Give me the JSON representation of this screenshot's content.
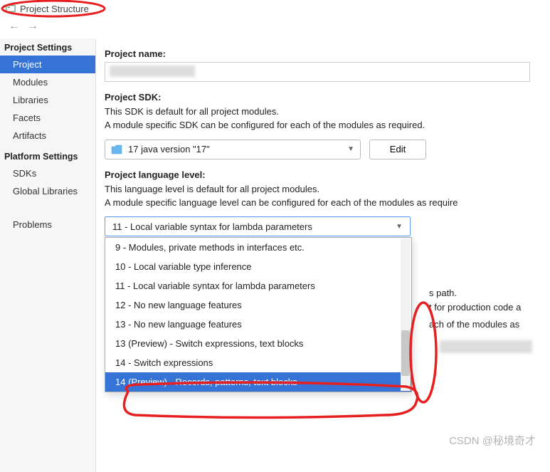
{
  "title": "Project Structure",
  "sidebar": {
    "heading1": "Project Settings",
    "items1": [
      "Project",
      "Modules",
      "Libraries",
      "Facets",
      "Artifacts"
    ],
    "heading2": "Platform Settings",
    "items2": [
      "SDKs",
      "Global Libraries"
    ],
    "problems": "Problems"
  },
  "content": {
    "projectName": {
      "label": "Project name:"
    },
    "sdk": {
      "label": "Project SDK:",
      "help1": "This SDK is default for all project modules.",
      "help2": "A module specific SDK can be configured for each of the modules as required.",
      "value": "17 java version \"17\"",
      "editLabel": "Edit"
    },
    "lang": {
      "label": "Project language level:",
      "help1": "This language level is default for all project modules.",
      "help2": "A module specific language level can be configured for each of the modules as require",
      "selected": "11 - Local variable syntax for lambda parameters",
      "options": [
        "9 - Modules, private methods in interfaces etc.",
        "10 - Local variable type inference",
        "11 - Local variable syntax for lambda parameters",
        "12 - No new language features",
        "13 - No new language features",
        "13 (Preview) - Switch expressions, text blocks",
        "14 - Switch expressions",
        "14 (Preview) - Records, patterns, text blocks"
      ],
      "highlightIndex": 7
    },
    "bg": {
      "t1": "s path.",
      "t2": "t for production code a",
      "t3": "ach of the modules as "
    }
  },
  "watermark": "CSDN @秘境奇才"
}
